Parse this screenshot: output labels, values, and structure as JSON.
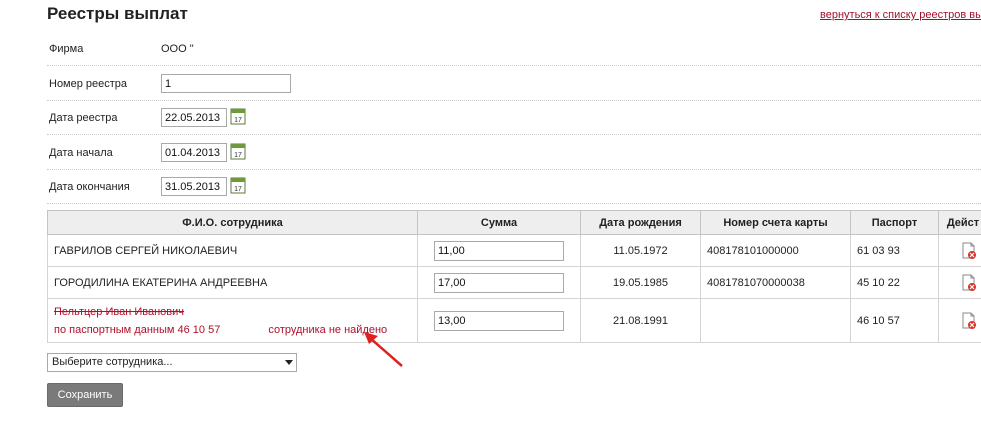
{
  "page": {
    "title": "Реестры выплат",
    "back_link": "вернуться к списку реестров вы"
  },
  "form": {
    "firm_label": "Фирма",
    "firm_value": "ООО \"",
    "number_label": "Номер реестра",
    "number_value": "1",
    "date_label": "Дата реестра",
    "date_value": "22.05.2013",
    "start_label": "Дата начала",
    "start_value": "01.04.2013",
    "end_label": "Дата окончания",
    "end_value": "31.05.2013",
    "calendar_icon": "calendar-icon",
    "calendar_day": "17"
  },
  "table": {
    "headers": [
      "Ф.И.О. сотрудника",
      "Сумма",
      "Дата рождения",
      "Номер счета карты",
      "Паспорт",
      "Дейст"
    ],
    "rows": [
      {
        "name": "ГАВРИЛОВ СЕРГЕЙ НИКОЛАЕВИЧ",
        "sum": "11,00",
        "birth": "11.05.1972",
        "card": "408178101000000",
        "passport": "61 03 93"
      },
      {
        "name": "ГОРОДИЛИНА ЕКАТЕРИНА АНДРЕЕВНА",
        "sum": "17,00",
        "birth": "19.05.1985",
        "card": "4081781070000038",
        "passport": "45 10 22"
      },
      {
        "name": "Пельтцер Иван Иванович",
        "error_prefix": "по паспортным данным 46 10 57",
        "error_suffix": "сотрудника не найдено",
        "sum": "13,00",
        "birth": "21.08.1991",
        "card": "",
        "passport": "46 10 57"
      }
    ],
    "action_icon": "delete-document-icon"
  },
  "select": {
    "value": "Выберите сотрудника..."
  },
  "buttons": {
    "save": "Сохранить"
  },
  "colors": {
    "error": "#b0102a",
    "link": "#a0102a",
    "button": "#7a7a7a",
    "annotation": "#e02020"
  }
}
